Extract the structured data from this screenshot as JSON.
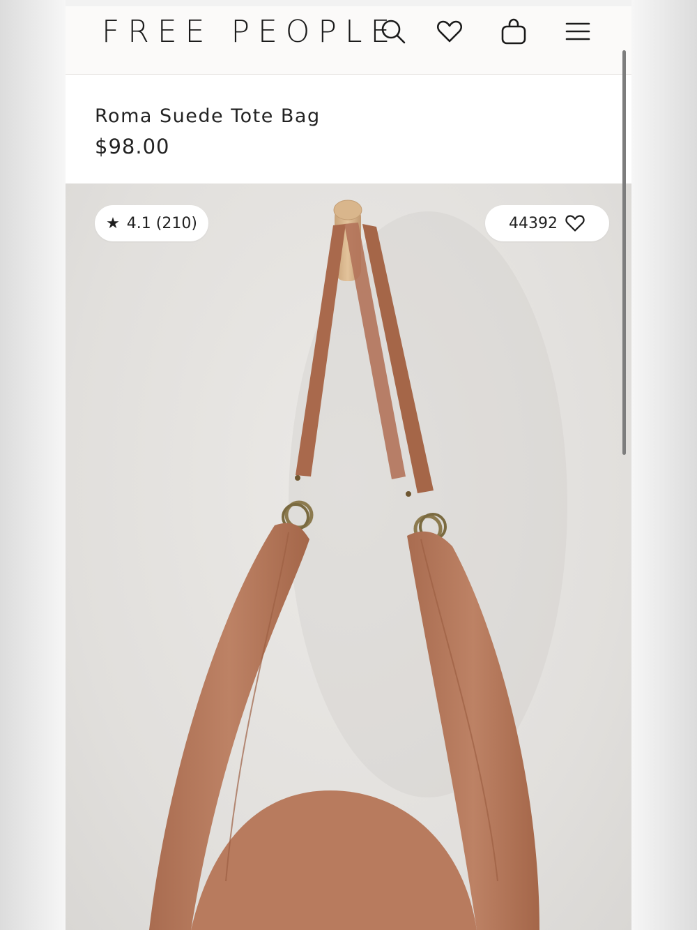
{
  "header": {
    "logo": "FREE PEOPLE",
    "icons": [
      "search-icon",
      "heart-icon",
      "shopping-bag-icon",
      "menu-icon"
    ]
  },
  "product": {
    "title": "Roma Suede Tote Bag",
    "price": "$98.00",
    "rating": {
      "star": "★",
      "text": "4.1 (210)"
    },
    "likes": "44392"
  },
  "colors": {
    "text": "#1a1a1a",
    "background": "#fbfaf9",
    "suede": "#b77a5e",
    "wall": "#e5e3e0"
  }
}
